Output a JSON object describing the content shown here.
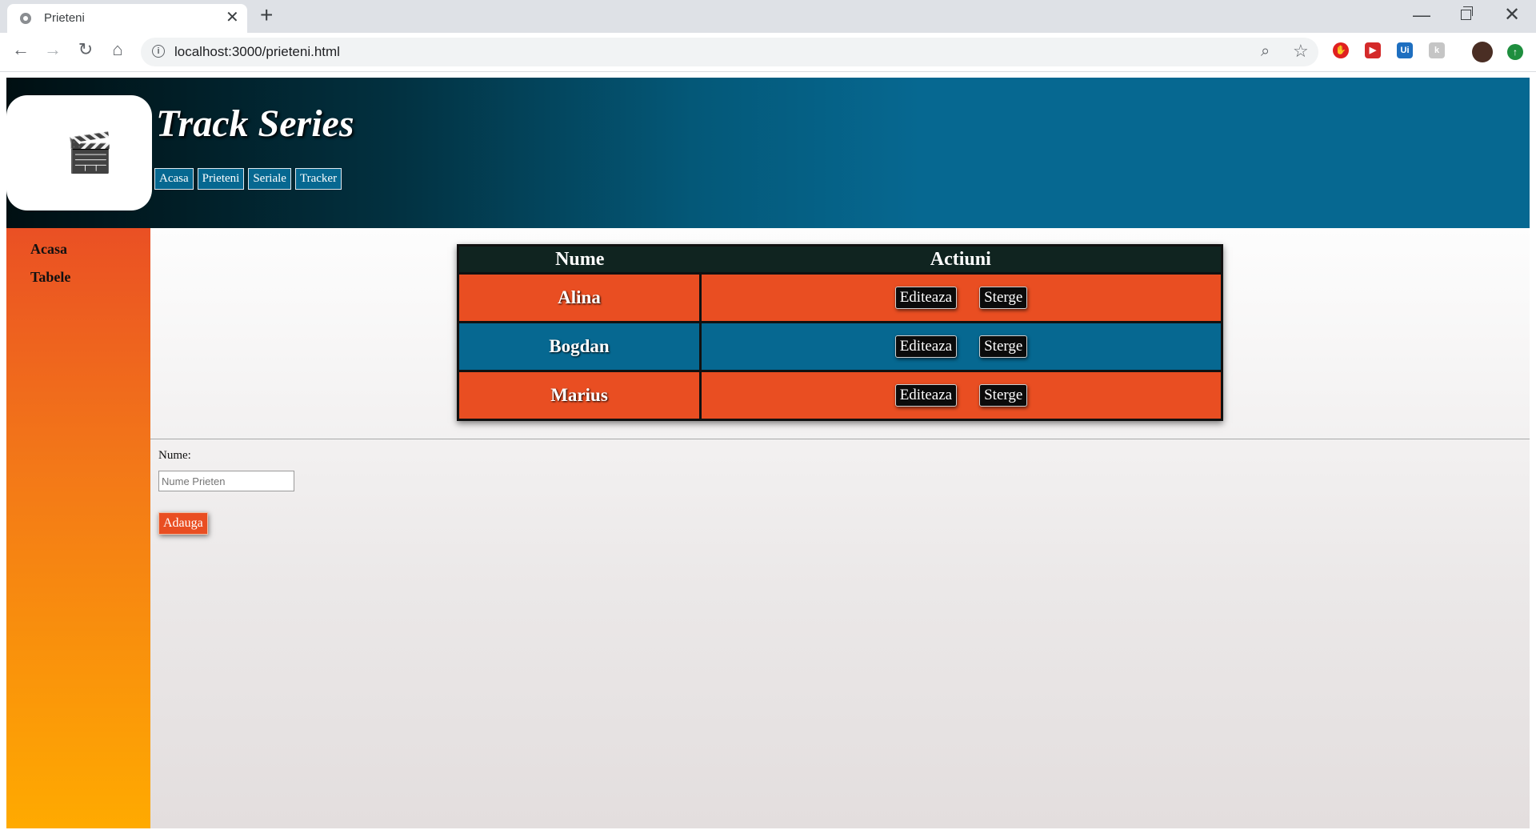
{
  "browser": {
    "tab_title": "Prieteni",
    "url": "localhost:3000/prieteni.html"
  },
  "header": {
    "site_title": "Track Series",
    "nav": [
      "Acasa",
      "Prieteni",
      "Seriale",
      "Tracker"
    ]
  },
  "sidebar": {
    "items": [
      "Acasa",
      "Tabele"
    ]
  },
  "table": {
    "columns": [
      "Nume",
      "Actiuni"
    ],
    "rows": [
      {
        "name": "Alina",
        "color": "#e94e22"
      },
      {
        "name": "Bogdan",
        "color": "#066891"
      },
      {
        "name": "Marius",
        "color": "#e94e22"
      }
    ],
    "edit_label": "Editeaza",
    "delete_label": "Sterge"
  },
  "form": {
    "label": "Nume:",
    "placeholder": "Nume Prieten",
    "value": "",
    "submit_label": "Adauga"
  },
  "colors": {
    "accent_orange": "#e94e22",
    "accent_blue": "#066891"
  }
}
